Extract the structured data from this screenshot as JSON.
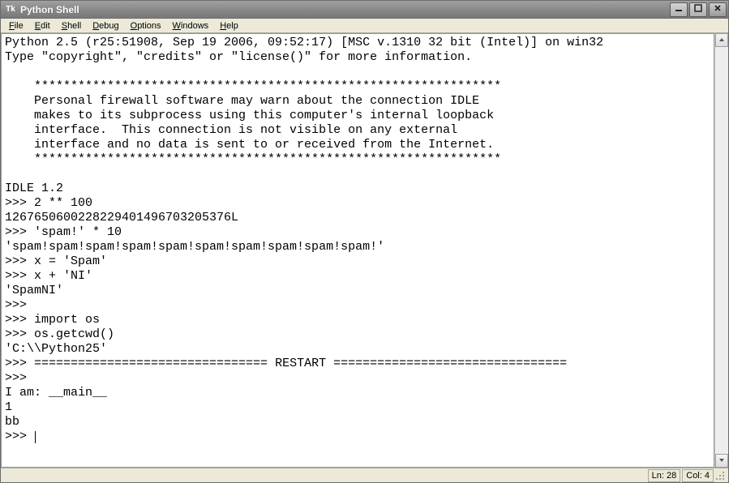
{
  "window": {
    "title": "Python Shell",
    "icon_text": "Tk"
  },
  "menu": {
    "items": [
      {
        "label": "File",
        "u": 0
      },
      {
        "label": "Edit",
        "u": 0
      },
      {
        "label": "Shell",
        "u": 0
      },
      {
        "label": "Debug",
        "u": 0
      },
      {
        "label": "Options",
        "u": 0
      },
      {
        "label": "Windows",
        "u": 0
      },
      {
        "label": "Help",
        "u": 0
      }
    ]
  },
  "shell": {
    "line1": "Python 2.5 (r25:51908, Sep 19 2006, 09:52:17) [MSC v.1310 32 bit (Intel)] on win32",
    "line2": "Type \"copyright\", \"credits\" or \"license()\" for more information.",
    "blank1": "",
    "stars1": "    ****************************************************************",
    "fw1": "    Personal firewall software may warn about the connection IDLE",
    "fw2": "    makes to its subprocess using this computer's internal loopback",
    "fw3": "    interface.  This connection is not visible on any external",
    "fw4": "    interface and no data is sent to or received from the Internet.",
    "stars2": "    ****************************************************************",
    "blank2": "    ",
    "idle": "IDLE 1.2      ",
    "p1": ">>> ",
    "in1": "2 ** 100",
    "out1": "1267650600228229401496703205376L",
    "p2": ">>> ",
    "in2": "'spam!' * 10",
    "out2": "'spam!spam!spam!spam!spam!spam!spam!spam!spam!spam!'",
    "p3": ">>> ",
    "in3": "x = 'Spam'",
    "p4": ">>> ",
    "in4": "x + 'NI'",
    "out4": "'SpamNI'",
    "p5": ">>> ",
    "p6": ">>> ",
    "in6a": "import",
    "in6b": " os",
    "p7": ">>> ",
    "in7": "os.getcwd()",
    "out7": "'C:\\\\Python25'",
    "p8": ">>> ",
    "restart": "================================ RESTART ================================",
    "p9": ">>> ",
    "run1": "I am: __main__",
    "run2": "1",
    "run3": "bb",
    "p10": ">>> "
  },
  "status": {
    "ln": "Ln: 28",
    "col": "Col: 4"
  }
}
